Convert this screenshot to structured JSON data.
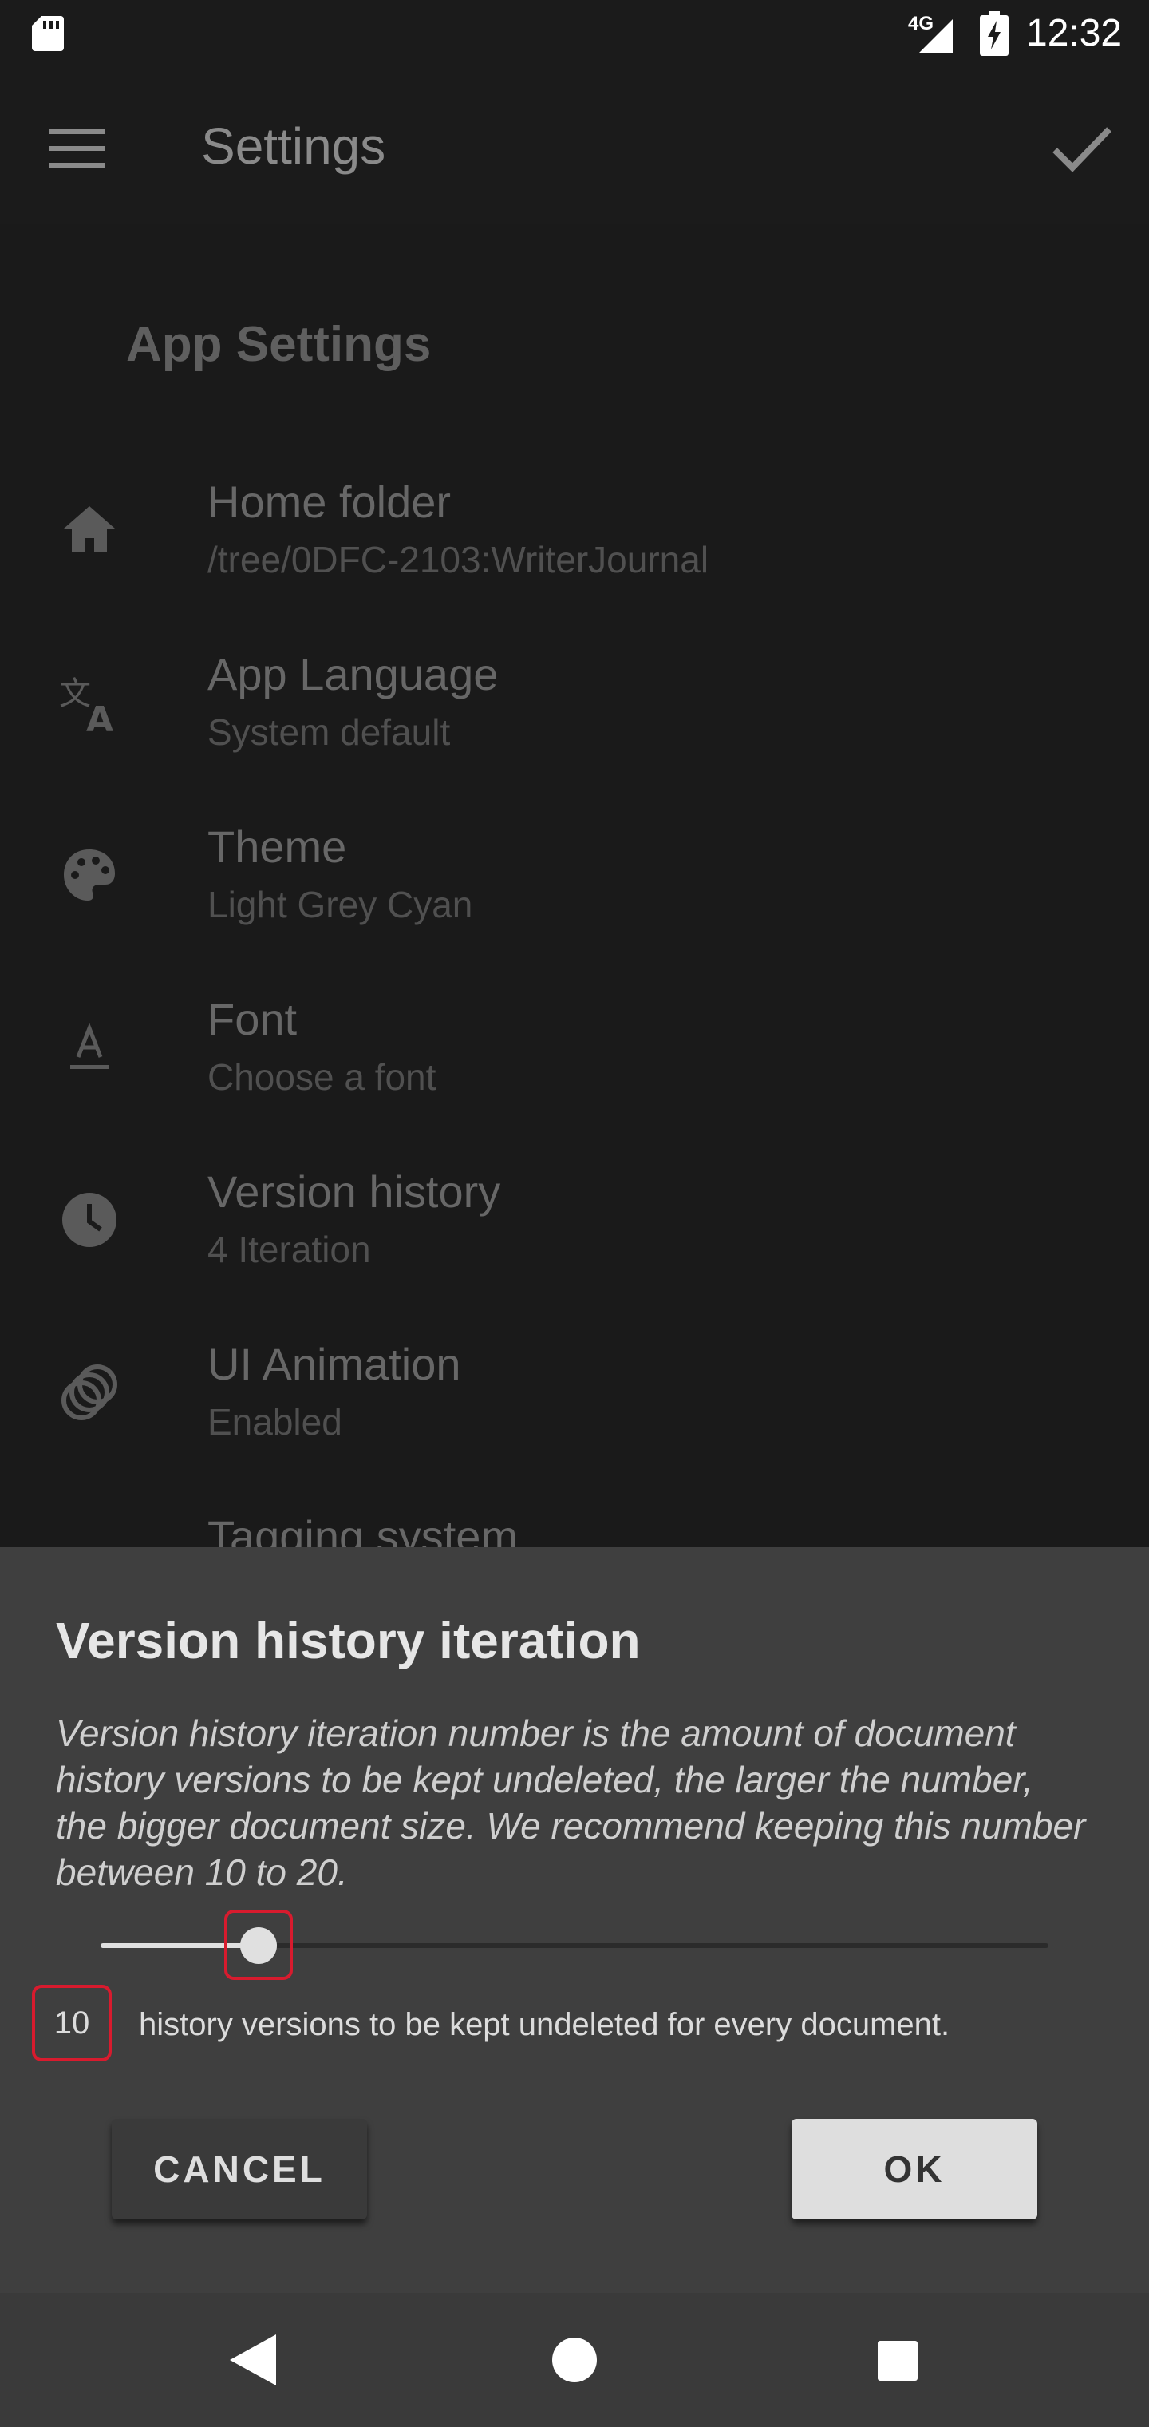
{
  "status_bar": {
    "network": "4G",
    "time": "12:32"
  },
  "app_bar": {
    "title": "Settings",
    "icons": [
      "menu-icon",
      "check-icon"
    ]
  },
  "settings": {
    "section_title": "App Settings",
    "items": [
      {
        "title": "Home folder",
        "subtitle": "/tree/0DFC-2103:WriterJournal",
        "icon": "home-icon"
      },
      {
        "title": "App Language",
        "subtitle": "System default",
        "icon": "translate-icon"
      },
      {
        "title": "Theme",
        "subtitle": "Light Grey Cyan",
        "icon": "palette-icon"
      },
      {
        "title": "Font",
        "subtitle": "Choose a font",
        "icon": "font-icon"
      },
      {
        "title": "Version history",
        "subtitle": "4 Iteration",
        "icon": "clock-icon"
      },
      {
        "title": "UI Animation",
        "subtitle": "Enabled",
        "icon": "animation-icon"
      },
      {
        "title": "Tagging system",
        "subtitle": "",
        "icon": "tag-icon"
      }
    ]
  },
  "dialog": {
    "title": "Version history iteration",
    "description": "Version history iteration number is the amount of document history versions to be kept undeleted, the larger the number, the bigger document size. We recommend keeping this number between 10 to 20.",
    "slider": {
      "value": 10,
      "fraction": 0.167
    },
    "value_text": "10",
    "value_suffix": "history versions to be kept undeleted for every document.",
    "cancel_label": "CANCEL",
    "ok_label": "OK"
  },
  "nav_bar": {
    "icons": [
      "back-icon",
      "home-circle-icon",
      "recents-icon"
    ]
  },
  "colors": {
    "highlight": "#d81b2e",
    "dialog_bg": "#3f3f3f",
    "accent": "#e0e0e0"
  }
}
